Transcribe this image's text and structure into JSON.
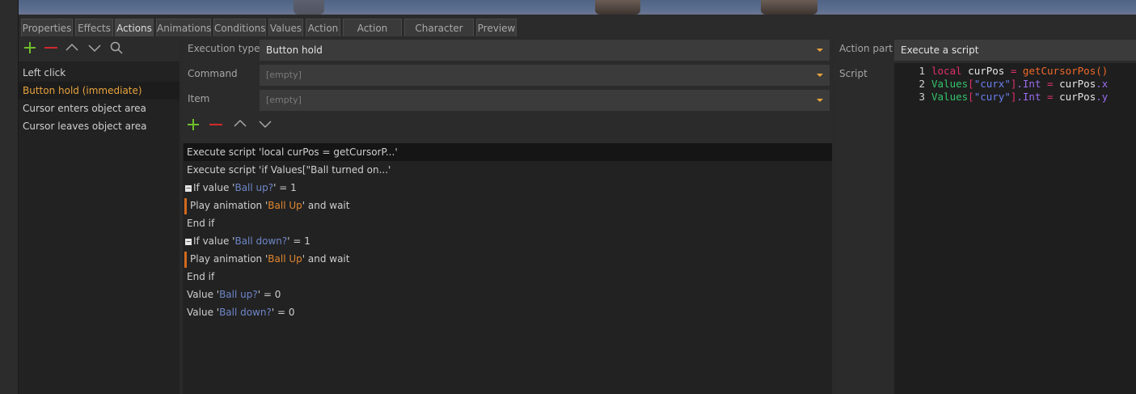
{
  "tabs": [
    "Properties",
    "Effects",
    "Actions",
    "Animations",
    "Conditions",
    "Values",
    "Action",
    "Action areas",
    "Character size",
    "Preview"
  ],
  "active_tab": "Actions",
  "events": {
    "items": [
      "Left click",
      "Button hold (immediate)",
      "Cursor enters object area",
      "Cursor leaves object area"
    ],
    "selected": "Button hold (immediate)"
  },
  "properties": {
    "execution_type_label": "Execution type",
    "execution_type_value": "Button hold",
    "command_label": "Command",
    "command_value": "[empty]",
    "item_label": "Item",
    "item_value": "[empty]"
  },
  "actions": [
    {
      "prefix": "Execute script 'local curPos = getCursorP...'",
      "selected": true
    },
    {
      "prefix": "Execute script 'if Values[\"Ball turned on...'"
    },
    {
      "prefix": "If value '",
      "name": "Ball up?",
      "suffix": "' = 1",
      "collapse": true
    },
    {
      "prefix": "Play animation '",
      "anim": "Ball Up",
      "suffix": "' and wait",
      "indent": true
    },
    {
      "prefix": "End if"
    },
    {
      "prefix": "If value '",
      "name": "Ball down?",
      "suffix": "' = 1",
      "collapse": true
    },
    {
      "prefix": "Play animation '",
      "anim": "Ball Up",
      "suffix": "' and wait",
      "indent": true
    },
    {
      "prefix": "End if"
    },
    {
      "prefix": "Value '",
      "name": "Ball up?",
      "suffix": "' = 0"
    },
    {
      "prefix": "Value '",
      "name": "Ball down?",
      "suffix": "' = 0"
    }
  ],
  "action_part": {
    "label": "Action part",
    "value": "Execute a script",
    "script_label": "Script"
  },
  "script_lines": [
    {
      "n": "1",
      "tokens": [
        [
          "kw",
          "local"
        ],
        [
          "plain",
          " curPos "
        ],
        [
          "op",
          "="
        ],
        [
          "plain",
          " "
        ],
        [
          "fn",
          "getCursorPos()"
        ]
      ]
    },
    {
      "n": "2",
      "tokens": [
        [
          "green",
          "Values"
        ],
        [
          "op",
          "["
        ],
        [
          "str",
          "\"curx\""
        ],
        [
          "op",
          "]"
        ],
        [
          "prop",
          ".Int"
        ],
        [
          "plain",
          " "
        ],
        [
          "op",
          "="
        ],
        [
          "plain",
          " curPos"
        ],
        [
          "prop",
          ".x"
        ]
      ]
    },
    {
      "n": "3",
      "tokens": [
        [
          "green",
          "Values"
        ],
        [
          "op",
          "["
        ],
        [
          "str",
          "\"cury\""
        ],
        [
          "op",
          "]"
        ],
        [
          "prop",
          ".Int"
        ],
        [
          "plain",
          " "
        ],
        [
          "op",
          "="
        ],
        [
          "plain",
          " curPos"
        ],
        [
          "prop",
          ".y"
        ]
      ]
    }
  ],
  "icons": [
    "add-icon",
    "remove-icon",
    "move-up-icon",
    "move-down-icon",
    "search-icon"
  ],
  "colors": {
    "accent": "#e8a33d",
    "add": "#6fbf2a",
    "remove": "#d2292b",
    "link_blue": "#6e86c8",
    "anim_orange": "#e0862f"
  }
}
